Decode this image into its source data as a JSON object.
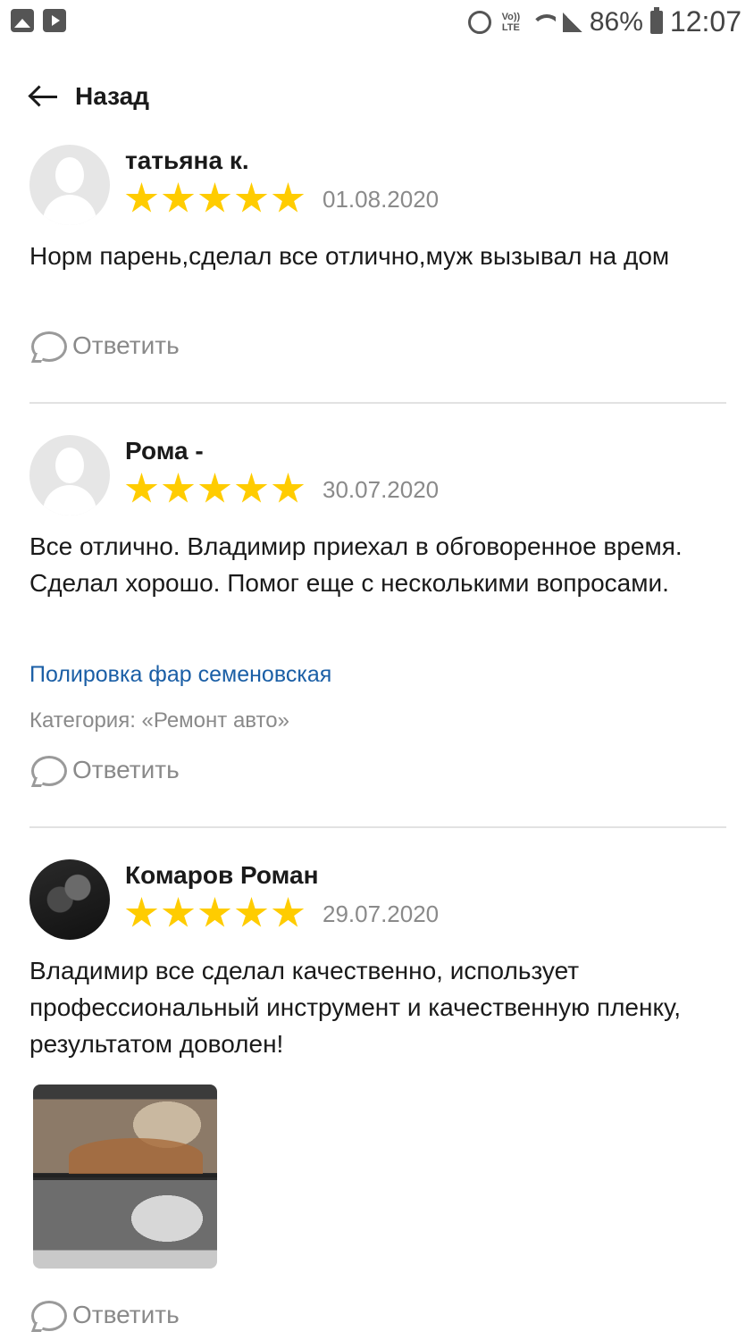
{
  "status_bar": {
    "lte": "Vo)) LTE",
    "battery": "86%",
    "time": "12:07"
  },
  "header": {
    "back_label": "Назад"
  },
  "reviews": [
    {
      "author": "татьяна к.",
      "rating": 5,
      "date": "01.08.2020",
      "text": "Норм парень,сделал все отлично,муж вызывал на дом",
      "reply": "Ответить"
    },
    {
      "author": "Рома -",
      "rating": 5,
      "date": "30.07.2020",
      "text": "Все отлично. Владимир приехал в обговоренное время. Сделал хорошо. Помог еще с несколькими вопросами.",
      "service": "Полировка фар семеновская",
      "category": "Категория: «Ремонт авто»",
      "reply": "Ответить"
    },
    {
      "author": "Комаров Роман",
      "rating": 5,
      "date": "29.07.2020",
      "text": "Владимир все сделал качественно, использует профессиональный инструмент и качественную пленку, результатом доволен!",
      "reply": "Ответить"
    }
  ],
  "colors": {
    "star": "#ffcc00",
    "link": "#1b5fa6",
    "muted": "#8a8a8a"
  }
}
